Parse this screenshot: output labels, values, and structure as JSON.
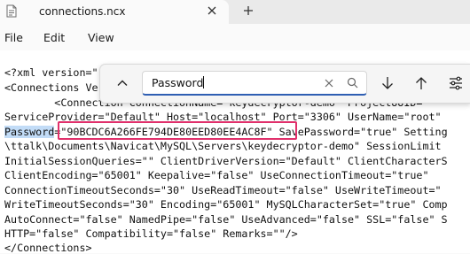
{
  "tab": {
    "title": "connections.ncx"
  },
  "menu": {
    "file": "File",
    "edit": "Edit",
    "view": "View"
  },
  "find": {
    "value": "Password"
  },
  "lines": [
    "<?xml version=\"",
    "<Connections Ve",
    "        <Connection ConnectionName=\"keydecryptor-demo\" ProjectUUID=\"\"",
    "ServiceProvider=\"Default\" Host=\"localhost\" Port=\"3306\" UserName=\"root\"",
    "\\ttalk\\Documents\\Navicat\\MySQL\\Servers\\keydecryptor-demo\" SessionLimit",
    "InitialSessionQueries=\"\" ClientDriverVersion=\"Default\" ClientCharacterS",
    "ClientEncoding=\"65001\" Keepalive=\"false\" UseConnectionTimeout=\"true\"",
    "ConnectionTimeoutSeconds=\"30\" UseReadTimeout=\"false\" UseWriteTimeout=\"",
    "WriteTimeoutSeconds=\"30\" Encoding=\"65001\" MySQLCharacterSet=\"true\" Comp",
    "AutoConnect=\"false\" NamedPipe=\"false\" UseAdvanced=\"false\" SSL=\"false\" S",
    "HTTP=\"false\" Compatibility=\"false\" Remarks=\"\"/>",
    "</Connections>"
  ],
  "password_line": {
    "match": "Password",
    "value": "=\"90BCDC6A266FE794DE80EED80EE4AC8F\"",
    "rest": " SavePassword=\"true\" Setting"
  }
}
